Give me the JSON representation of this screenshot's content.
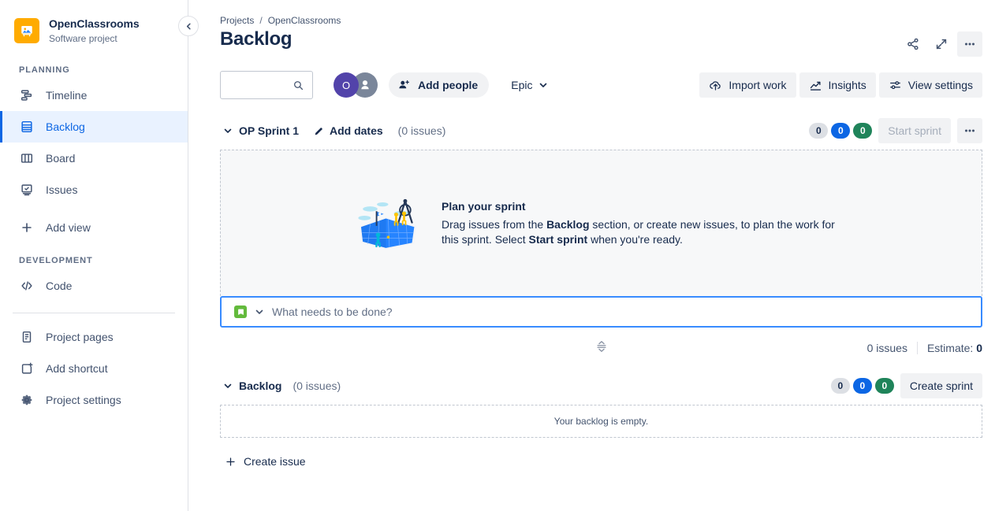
{
  "sidebar": {
    "project": {
      "name": "OpenClassrooms",
      "type": "Software project",
      "avatar_icon": "image-placeholder-icon",
      "avatar_color": "#FFAB00"
    },
    "collapse_icon": "chevron-left-icon",
    "groups": [
      {
        "label": "PLANNING",
        "items": [
          {
            "label": "Timeline",
            "icon": "timeline-icon",
            "active": false
          },
          {
            "label": "Backlog",
            "icon": "backlog-icon",
            "active": true
          },
          {
            "label": "Board",
            "icon": "board-icon",
            "active": false
          },
          {
            "label": "Issues",
            "icon": "issues-icon",
            "active": false
          }
        ]
      }
    ],
    "add_view": {
      "label": "Add view",
      "icon": "plus-icon"
    },
    "development_label": "DEVELOPMENT",
    "code": {
      "label": "Code",
      "icon": "code-icon"
    },
    "footer_items": [
      {
        "label": "Project pages",
        "icon": "pages-icon"
      },
      {
        "label": "Add shortcut",
        "icon": "add-shortcut-icon"
      },
      {
        "label": "Project settings",
        "icon": "gear-icon"
      }
    ]
  },
  "header": {
    "breadcrumbs": [
      "Projects",
      "OpenClassrooms"
    ],
    "breadcrumb_separator": "/",
    "title": "Backlog",
    "actions": [
      {
        "name": "share",
        "icon": "share-icon",
        "filled": false
      },
      {
        "name": "expand",
        "icon": "expand-icon",
        "filled": false
      },
      {
        "name": "more",
        "icon": "more-horizontal-icon",
        "filled": true
      }
    ]
  },
  "toolbar": {
    "search": {
      "value": "",
      "placeholder": "",
      "icon": "search-icon"
    },
    "avatars": [
      {
        "initial": "O",
        "color": "#5243AA"
      },
      {
        "initial": "",
        "color": "#7A869A"
      }
    ],
    "add_people": {
      "label": "Add people",
      "icon": "person-add-icon"
    },
    "epic_filter": {
      "label": "Epic",
      "icon": "chevron-down-icon"
    },
    "buttons": [
      {
        "label": "Import work",
        "icon": "import-icon"
      },
      {
        "label": "Insights",
        "icon": "insights-icon"
      },
      {
        "label": "View settings",
        "icon": "view-settings-icon"
      }
    ]
  },
  "sprint": {
    "collapse_icon": "chevron-down-icon",
    "name": "OP Sprint 1",
    "add_dates": {
      "label": "Add dates",
      "icon": "pencil-icon"
    },
    "issue_count": "(0 issues)",
    "badges": [
      {
        "value": "0",
        "style": "grey"
      },
      {
        "value": "0",
        "style": "blue"
      },
      {
        "value": "0",
        "style": "green"
      }
    ],
    "start_sprint": {
      "label": "Start sprint",
      "disabled": true
    },
    "more_icon": "more-horizontal-icon",
    "empty_state": {
      "illustration": "map-and-compass-illustration",
      "title": "Plan your sprint",
      "body_part1": "Drag issues from the ",
      "body_bold1": "Backlog",
      "body_part2": " section, or create new issues, to plan the work for this sprint. Select ",
      "body_bold2": "Start sprint",
      "body_part3": " when you're ready."
    },
    "create_row": {
      "type_icon": "story-icon",
      "type_icon_color": "#63BA3C",
      "type_chevron": "chevron-down-icon",
      "input_value": "",
      "input_placeholder": "What needs to be done?"
    },
    "footer": {
      "resize_icon": "resize-handle-icon",
      "issues_text": "0 issues",
      "estimate_label": "Estimate: ",
      "estimate_value": "0"
    }
  },
  "backlog": {
    "collapse_icon": "chevron-down-icon",
    "name": "Backlog",
    "issue_count": "(0 issues)",
    "badges": [
      {
        "value": "0",
        "style": "grey"
      },
      {
        "value": "0",
        "style": "blue"
      },
      {
        "value": "0",
        "style": "green"
      }
    ],
    "create_sprint": {
      "label": "Create sprint"
    },
    "empty_text": "Your backlog is empty.",
    "create_issue": {
      "label": "Create issue",
      "icon": "plus-icon"
    }
  }
}
